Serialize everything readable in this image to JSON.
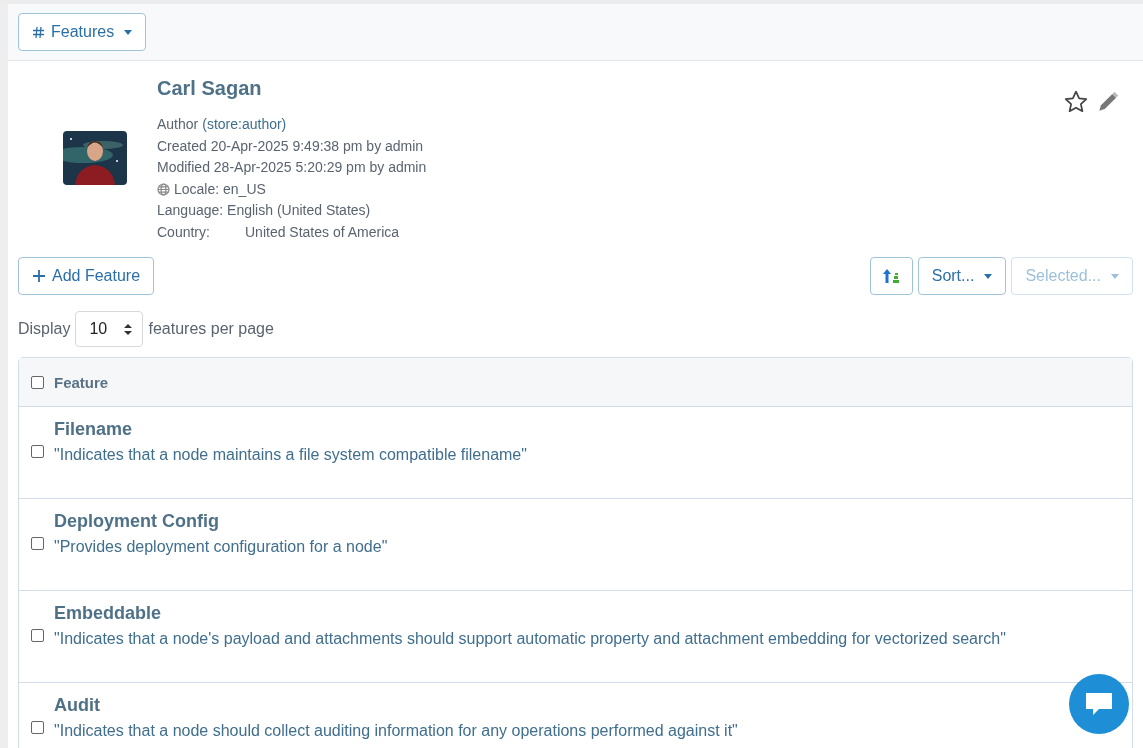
{
  "toolbar": {
    "features_menu": {
      "label": "Features"
    }
  },
  "node": {
    "title": "Carl Sagan",
    "type_label": "Author",
    "type_id": "(store:author)",
    "created": "Created 20-Apr-2025 9:49:38 pm by admin",
    "modified": "Modified 28-Apr-2025 5:20:29 pm by admin",
    "locale": "Locale: en_US",
    "language": "Language: English (United States)",
    "country_label": "Country:",
    "country_value": "United States of America",
    "starred": false
  },
  "actions": {
    "add_button": "Add Feature",
    "sort_button": "Sort...",
    "selected_button": {
      "label": "Selected...",
      "disabled": true
    }
  },
  "paging": {
    "prefix": "Display",
    "page_size": "10",
    "suffix": "features per page"
  },
  "table": {
    "columns": [
      "Feature"
    ],
    "all_checked": false,
    "rows": [
      {
        "name": "Filename",
        "description": "\"Indicates that a node maintains a file system compatible filename\"",
        "checked": false
      },
      {
        "name": "Deployment Config",
        "description": "\"Provides deployment configuration for a node\"",
        "checked": false
      },
      {
        "name": "Embeddable",
        "description": "\"Indicates that a node's payload and attachments should support automatic property and attachment embedding for vectorized search\"",
        "checked": false
      },
      {
        "name": "Audit",
        "description": "\"Indicates that a node should collect auditing information for any operations performed against it\"",
        "checked": false
      }
    ]
  }
}
